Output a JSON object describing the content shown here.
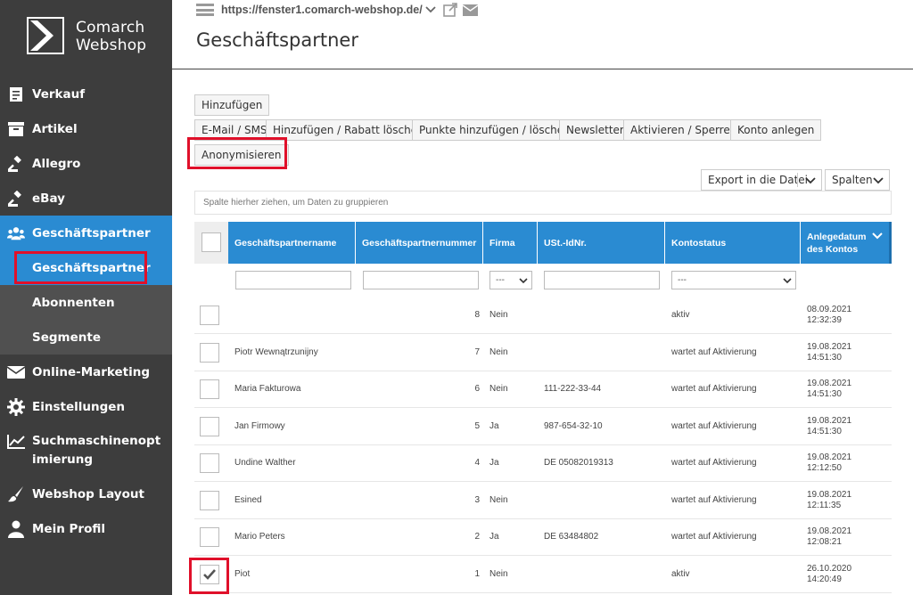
{
  "brand": {
    "line1": "Comarch",
    "line2": "Webshop"
  },
  "sidebar": {
    "items": [
      {
        "label": "Verkauf",
        "icon": "receipt-icon"
      },
      {
        "label": "Artikel",
        "icon": "box-icon"
      },
      {
        "label": "Allegro",
        "icon": "gavel-icon"
      },
      {
        "label": "eBay",
        "icon": "gavel-icon"
      },
      {
        "label": "Geschäftspartner",
        "icon": "users-icon"
      },
      {
        "label": "Online-Marketing",
        "icon": "envelope-icon"
      },
      {
        "label": "Einstellungen",
        "icon": "gear-icon"
      },
      {
        "label": "Suchmaschinenopt imierung",
        "line1": "Suchmaschinenopt",
        "line2": "imierung",
        "icon": "chart-icon"
      },
      {
        "label": "Webshop Layout",
        "icon": "brush-icon"
      },
      {
        "label": "Mein Profil",
        "icon": "user-icon"
      }
    ],
    "subitems": [
      {
        "label": "Geschäftspartner"
      },
      {
        "label": "Abonnenten"
      },
      {
        "label": "Segmente"
      }
    ]
  },
  "header": {
    "url": "https://fenster1.comarch-webshop.de/",
    "title": "Geschäftspartner"
  },
  "toolbar": {
    "add": "Hinzufügen",
    "row2": [
      "E-Mail / SMS",
      "Hinzufügen / Rabatt löschen",
      "Punkte hinzufügen / löschen",
      "Newsletter",
      "Aktivieren / Sperren",
      "Konto anlegen"
    ],
    "anonymize": "Anonymisieren",
    "export": "Export in die Datei",
    "columns": "Spalten"
  },
  "grouping_hint": "Spalte hierher ziehen, um Daten zu gruppieren",
  "table": {
    "headers": {
      "name": "Geschäftspartnername",
      "number": "Geschäftspartnernummer",
      "firma": "Firma",
      "ust": "USt.-IdNr.",
      "status": "Kontostatus",
      "date_l1": "Anlegedatum",
      "date_l2": "des Kontos"
    },
    "filters": {
      "firma": "---",
      "status": "---"
    },
    "rows": [
      {
        "name": "",
        "number": "8",
        "firma": "Nein",
        "ust": "",
        "status": "aktiv",
        "date": "08.09.2021",
        "time": "12:32:39",
        "checked": false
      },
      {
        "name": "Piotr Wewnątrzunijny",
        "number": "7",
        "firma": "Nein",
        "ust": "",
        "status": "wartet auf Aktivierung",
        "date": "19.08.2021",
        "time": "14:51:30",
        "checked": false
      },
      {
        "name": "Maria Fakturowa",
        "number": "6",
        "firma": "Nein",
        "ust": "111-222-33-44",
        "status": "wartet auf Aktivierung",
        "date": "19.08.2021",
        "time": "14:51:30",
        "checked": false
      },
      {
        "name": "Jan Firmowy",
        "number": "5",
        "firma": "Ja",
        "ust": "987-654-32-10",
        "status": "wartet auf Aktivierung",
        "date": "19.08.2021",
        "time": "14:51:30",
        "checked": false
      },
      {
        "name": "Undine Walther",
        "number": "4",
        "firma": "Ja",
        "ust": "DE 05082019313",
        "status": "wartet auf Aktivierung",
        "date": "19.08.2021",
        "time": "12:12:50",
        "checked": false
      },
      {
        "name": "Esined",
        "number": "3",
        "firma": "Nein",
        "ust": "",
        "status": "wartet auf Aktivierung",
        "date": "19.08.2021",
        "time": "12:11:35",
        "checked": false
      },
      {
        "name": "Mario Peters",
        "number": "2",
        "firma": "Ja",
        "ust": "DE 63484802",
        "status": "wartet auf Aktivierung",
        "date": "19.08.2021",
        "time": "12:08:21",
        "checked": false
      },
      {
        "name": "Piot",
        "number": "1",
        "firma": "Nein",
        "ust": "",
        "status": "aktiv",
        "date": "26.10.2020",
        "time": "14:20:49",
        "checked": true
      }
    ]
  },
  "colors": {
    "sidebar": "#3d3d3d",
    "accent": "#2a8bd2",
    "highlight": "#e0102a"
  }
}
